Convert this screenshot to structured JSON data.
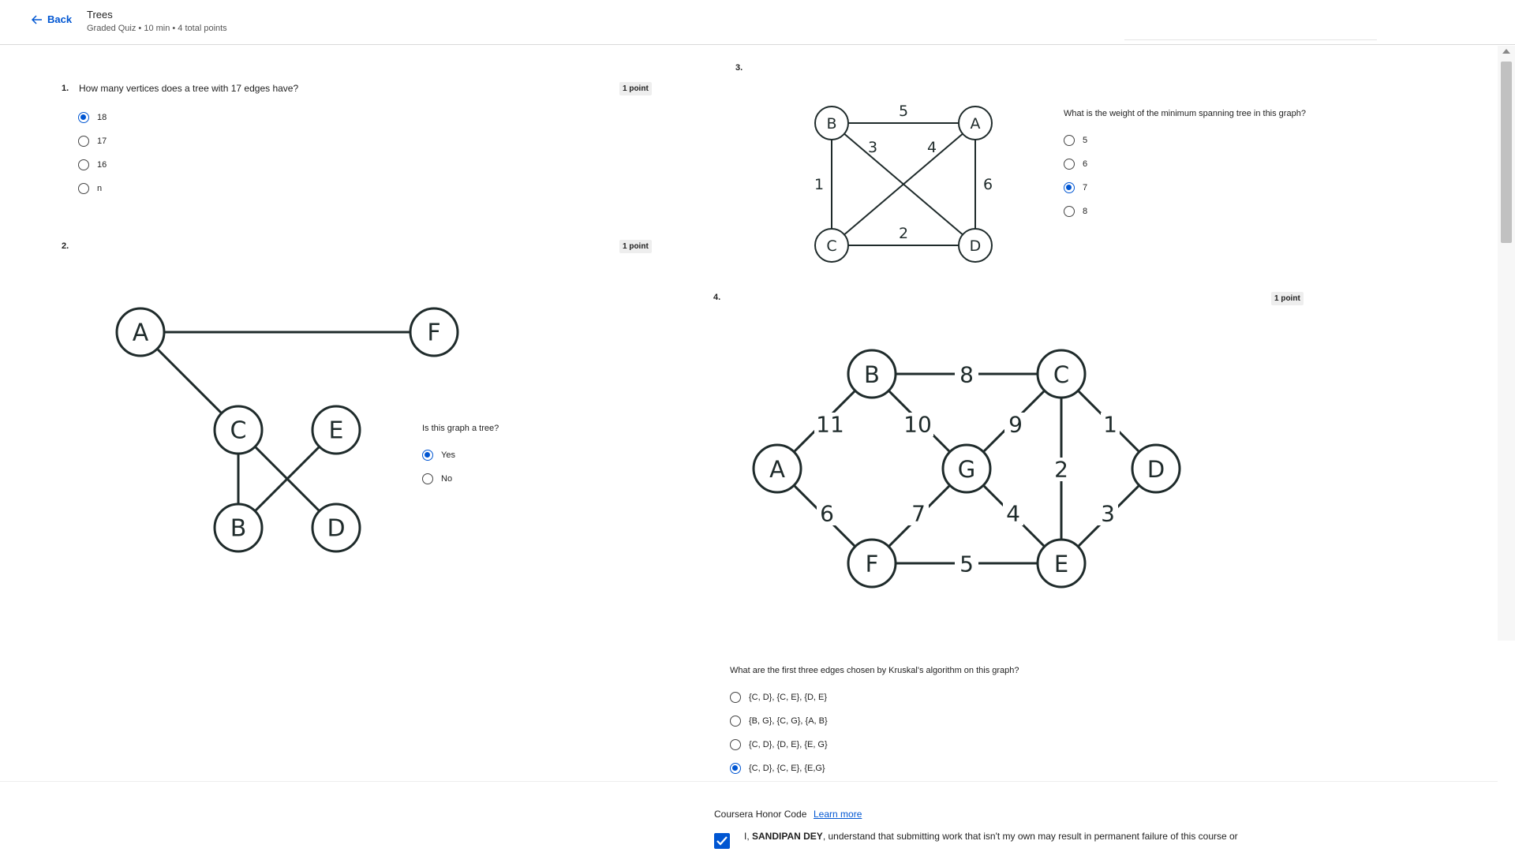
{
  "header": {
    "back_label": "Back",
    "title": "Trees",
    "subtitle": "Graded Quiz • 10 min • 4 total points"
  },
  "questions": [
    {
      "number": "1.",
      "text": "How many vertices does a tree with 17 edges have?",
      "points": "1 point",
      "options": [
        {
          "label": "18",
          "selected": true
        },
        {
          "label": "17",
          "selected": false
        },
        {
          "label": "16",
          "selected": false
        },
        {
          "label": "n",
          "selected": false
        }
      ]
    },
    {
      "number": "2.",
      "text": "Is this graph a tree?",
      "points": "1 point",
      "options": [
        {
          "label": "Yes",
          "selected": true
        },
        {
          "label": "No",
          "selected": false
        }
      ],
      "graph": {
        "nodes": [
          "A",
          "F",
          "C",
          "E",
          "B",
          "D"
        ],
        "edges": [
          [
            "A",
            "F"
          ],
          [
            "A",
            "C"
          ],
          [
            "C",
            "B"
          ],
          [
            "C",
            "D"
          ],
          [
            "E",
            "B"
          ]
        ]
      }
    },
    {
      "number": "3.",
      "text": "What is the weight of the minimum spanning tree in this graph?",
      "options": [
        {
          "label": "5",
          "selected": false
        },
        {
          "label": "6",
          "selected": false
        },
        {
          "label": "7",
          "selected": true
        },
        {
          "label": "8",
          "selected": false
        }
      ],
      "graph": {
        "nodes": [
          "B",
          "A",
          "C",
          "D"
        ],
        "edges": [
          {
            "from": "B",
            "to": "A",
            "weight": "5"
          },
          {
            "from": "B",
            "to": "D",
            "weight": "3"
          },
          {
            "from": "C",
            "to": "A",
            "weight": "4"
          },
          {
            "from": "B",
            "to": "C",
            "weight": "1"
          },
          {
            "from": "A",
            "to": "D",
            "weight": "6"
          },
          {
            "from": "C",
            "to": "D",
            "weight": "2"
          }
        ]
      }
    },
    {
      "number": "4.",
      "text": "What are the first three edges chosen by Kruskal's algorithm on this graph?",
      "points": "1 point",
      "options": [
        {
          "label": "{C, D}, {C, E}, {D, E}",
          "selected": false
        },
        {
          "label": "{B, G}, {C, G}, {A, B}",
          "selected": false
        },
        {
          "label": "{C, D}, {D, E}, {E, G}",
          "selected": false
        },
        {
          "label": "{C, D}, {C, E}, {E,G}",
          "selected": true
        }
      ],
      "graph": {
        "nodes": [
          "B",
          "C",
          "A",
          "G",
          "D",
          "F",
          "E"
        ],
        "edges": [
          {
            "from": "B",
            "to": "C",
            "weight": "8"
          },
          {
            "from": "A",
            "to": "B",
            "weight": "11"
          },
          {
            "from": "B",
            "to": "G",
            "weight": "10"
          },
          {
            "from": "G",
            "to": "C",
            "weight": "9"
          },
          {
            "from": "C",
            "to": "D",
            "weight": "1"
          },
          {
            "from": "C",
            "to": "E",
            "weight": "2"
          },
          {
            "from": "A",
            "to": "F",
            "weight": "6"
          },
          {
            "from": "F",
            "to": "G",
            "weight": "7"
          },
          {
            "from": "G",
            "to": "E",
            "weight": "4"
          },
          {
            "from": "D",
            "to": "E",
            "weight": "3"
          },
          {
            "from": "F",
            "to": "E",
            "weight": "5"
          }
        ]
      }
    }
  ],
  "honor": {
    "title": "Coursera Honor Code",
    "learn_more": "Learn more",
    "name": "SANDIPAN DEY",
    "prefix": "I, ",
    "text": ", understand that submitting work that isn't my own may result in permanent failure of this course or",
    "checked": true
  },
  "colors": {
    "accent": "#0056d2",
    "graph_stroke": "#1f2b2b"
  }
}
